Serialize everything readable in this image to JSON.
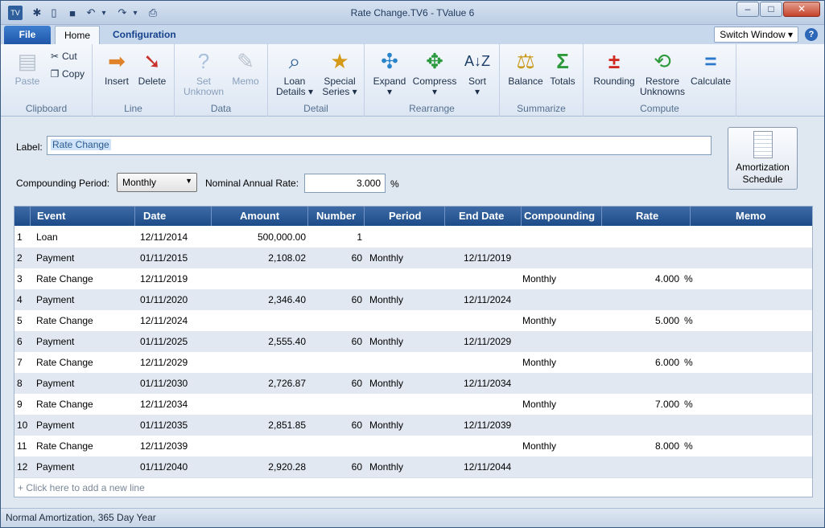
{
  "window": {
    "title": "Rate Change.TV6 - TValue 6",
    "minimize": "–",
    "maximize": "□",
    "close": "✕"
  },
  "qat": {
    "app": "TV",
    "new": "✱",
    "open": "▯",
    "save": "■",
    "undo": "↶",
    "redo": "↷",
    "print": "⎙",
    "dropdown": "▾"
  },
  "tabs": {
    "file": "File",
    "home": "Home",
    "configuration": "Configuration"
  },
  "switch_window": "Switch Window ▾",
  "help": "?",
  "ribbon": {
    "clipboard": {
      "label": "Clipboard",
      "paste": "Paste",
      "cut": "Cut",
      "copy": "Copy"
    },
    "line": {
      "label": "Line",
      "insert": "Insert",
      "delete": "Delete"
    },
    "data": {
      "label": "Data",
      "set_unknown_1": "Set",
      "set_unknown_2": "Unknown",
      "memo": "Memo"
    },
    "detail": {
      "label": "Detail",
      "loan_details_1": "Loan",
      "loan_details_2": "Details ▾",
      "special_series_1": "Special",
      "special_series_2": "Series ▾"
    },
    "rearrange": {
      "label": "Rearrange",
      "expand": "Expand",
      "compress": "Compress",
      "sort": "Sort",
      "dd": "▾"
    },
    "summarize": {
      "label": "Summarize",
      "balance": "Balance",
      "totals": "Totals"
    },
    "compute": {
      "label": "Compute",
      "rounding": "Rounding",
      "restore_1": "Restore",
      "restore_2": "Unknowns",
      "calculate": "Calculate"
    }
  },
  "form": {
    "label_caption": "Label:",
    "label_value": "Rate Change",
    "compounding_caption": "Compounding Period:",
    "compounding_value": "Monthly",
    "rate_caption": "Nominal Annual Rate:",
    "rate_value": "3.000",
    "rate_unit": "%",
    "amort_1": "Amortization",
    "amort_2": "Schedule"
  },
  "grid": {
    "headers": [
      "Event",
      "Date",
      "Amount",
      "Number",
      "Period",
      "End Date",
      "Compounding",
      "Rate",
      "Memo"
    ],
    "rows": [
      {
        "n": "1",
        "event": "Loan",
        "date": "12/11/2014",
        "amount": "500,000.00",
        "number": "1",
        "period": "",
        "end": "",
        "comp": "",
        "rate": "",
        "pct": ""
      },
      {
        "n": "2",
        "event": "Payment",
        "date": "01/11/2015",
        "amount": "2,108.02",
        "number": "60",
        "period": "Monthly",
        "end": "12/11/2019",
        "comp": "",
        "rate": "",
        "pct": ""
      },
      {
        "n": "3",
        "event": "Rate Change",
        "date": "12/11/2019",
        "amount": "",
        "number": "",
        "period": "",
        "end": "",
        "comp": "Monthly",
        "rate": "4.000",
        "pct": "%"
      },
      {
        "n": "4",
        "event": "Payment",
        "date": "01/11/2020",
        "amount": "2,346.40",
        "number": "60",
        "period": "Monthly",
        "end": "12/11/2024",
        "comp": "",
        "rate": "",
        "pct": ""
      },
      {
        "n": "5",
        "event": "Rate Change",
        "date": "12/11/2024",
        "amount": "",
        "number": "",
        "period": "",
        "end": "",
        "comp": "Monthly",
        "rate": "5.000",
        "pct": "%"
      },
      {
        "n": "6",
        "event": "Payment",
        "date": "01/11/2025",
        "amount": "2,555.40",
        "number": "60",
        "period": "Monthly",
        "end": "12/11/2029",
        "comp": "",
        "rate": "",
        "pct": ""
      },
      {
        "n": "7",
        "event": "Rate Change",
        "date": "12/11/2029",
        "amount": "",
        "number": "",
        "period": "",
        "end": "",
        "comp": "Monthly",
        "rate": "6.000",
        "pct": "%"
      },
      {
        "n": "8",
        "event": "Payment",
        "date": "01/11/2030",
        "amount": "2,726.87",
        "number": "60",
        "period": "Monthly",
        "end": "12/11/2034",
        "comp": "",
        "rate": "",
        "pct": ""
      },
      {
        "n": "9",
        "event": "Rate Change",
        "date": "12/11/2034",
        "amount": "",
        "number": "",
        "period": "",
        "end": "",
        "comp": "Monthly",
        "rate": "7.000",
        "pct": "%"
      },
      {
        "n": "10",
        "event": "Payment",
        "date": "01/11/2035",
        "amount": "2,851.85",
        "number": "60",
        "period": "Monthly",
        "end": "12/11/2039",
        "comp": "",
        "rate": "",
        "pct": ""
      },
      {
        "n": "11",
        "event": "Rate Change",
        "date": "12/11/2039",
        "amount": "",
        "number": "",
        "period": "",
        "end": "",
        "comp": "Monthly",
        "rate": "8.000",
        "pct": "%"
      },
      {
        "n": "12",
        "event": "Payment",
        "date": "01/11/2040",
        "amount": "2,920.28",
        "number": "60",
        "period": "Monthly",
        "end": "12/11/2044",
        "comp": "",
        "rate": "",
        "pct": ""
      }
    ],
    "add_line": "+   Click here to add a new line"
  },
  "status": "Normal Amortization, 365 Day Year"
}
